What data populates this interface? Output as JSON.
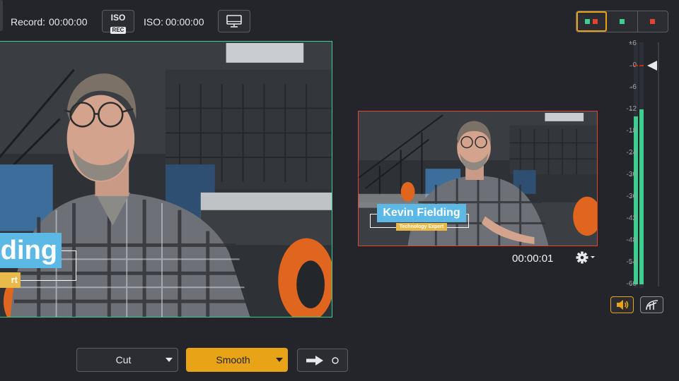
{
  "toolbar": {
    "record_label": "Record:",
    "record_time": "00:00:00",
    "iso_button_top": "ISO",
    "iso_button_badge": "REC",
    "iso_label": "ISO:",
    "iso_time": "00:00:00",
    "monitor_icon": "monitor-icon",
    "layouts": [
      {
        "name": "both-sources",
        "active": true
      },
      {
        "name": "green-source",
        "active": false
      },
      {
        "name": "red-source",
        "active": false
      }
    ]
  },
  "program": {
    "lower_third_name": "ding",
    "lower_third_title": "rt",
    "border_color": "#3ecf8e"
  },
  "preview": {
    "lower_third_name": "Kevin Fielding",
    "lower_third_title": "Technology Expert",
    "border_color": "#e4432d",
    "timecode": "00:00:01",
    "settings_icon": "gear-icon"
  },
  "audio_meter": {
    "scale": [
      "+6",
      "0",
      "-6",
      "-12",
      "-18",
      "-24",
      "-30",
      "-36",
      "-42",
      "-48",
      "-54",
      "-60"
    ],
    "left_level_db": -14,
    "right_level_db": -12,
    "fader_db": 0,
    "speaker_icon": "speaker-icon",
    "curve_icon": "fader-curve-icon"
  },
  "transitions": {
    "cut_label": "Cut",
    "smooth_label": "Smooth",
    "go_icon": "arrow-right-icon"
  },
  "colors": {
    "accent": "#e8a317",
    "program": "#3ecf8e",
    "preview": "#e4432d",
    "background": "#23252a"
  }
}
